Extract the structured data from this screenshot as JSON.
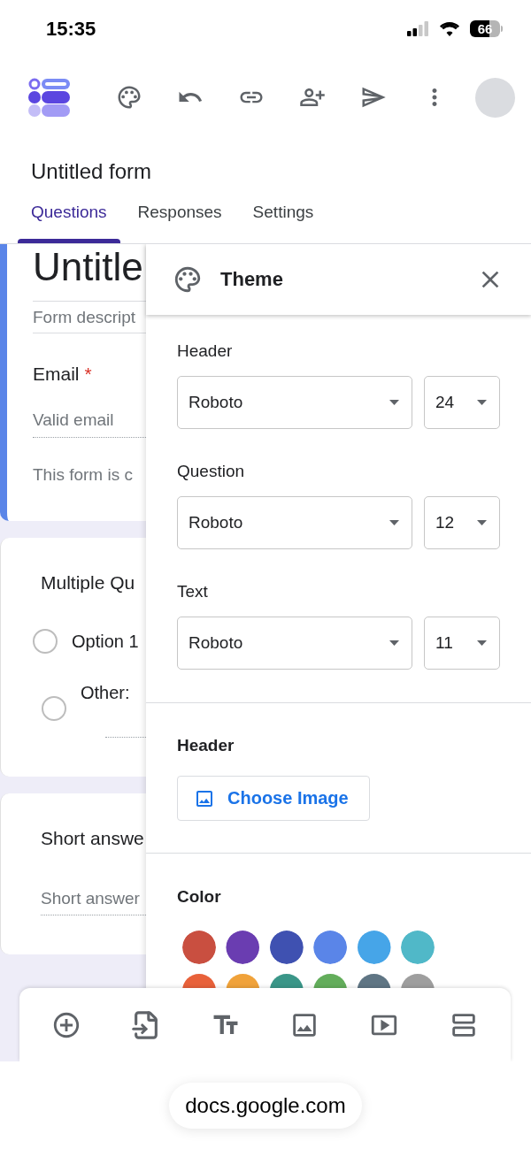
{
  "status_bar": {
    "time": "15:35",
    "battery": "66"
  },
  "form_title": "Untitled form",
  "tabs": [
    {
      "label": "Questions",
      "selected": true
    },
    {
      "label": "Responses",
      "selected": false
    },
    {
      "label": "Settings",
      "selected": false
    }
  ],
  "header_card": {
    "title": "Untitle",
    "description_placeholder": "Form descript",
    "question": {
      "label": "Email",
      "required_mark": "*",
      "placeholder": "Valid email"
    },
    "note": "This form is c"
  },
  "questions": [
    {
      "kind": "multiple_choice",
      "title": "Multiple Qu",
      "options": [
        {
          "kind": "option",
          "label": "Option 1",
          "selected": false
        },
        {
          "kind": "other",
          "label": "Other:",
          "selected": false
        }
      ]
    },
    {
      "kind": "short_answer",
      "title": "Short answe",
      "placeholder": "Short answer"
    }
  ],
  "theme_panel": {
    "title": "Theme",
    "text_styles": [
      {
        "label": "Header",
        "font": "Roboto",
        "size": "24"
      },
      {
        "label": "Question",
        "font": "Roboto",
        "size": "12"
      },
      {
        "label": "Text",
        "font": "Roboto",
        "size": "11"
      }
    ],
    "header_section": {
      "title": "Header",
      "button": "Choose Image"
    },
    "color_section": {
      "title": "Color",
      "colors": [
        {
          "color": "#c94f40"
        },
        {
          "color": "#6a3db1"
        },
        {
          "color": "#3f51b1"
        },
        {
          "color": "#5a85e8"
        },
        {
          "color": "#46a5e8"
        },
        {
          "color": "#50b8c8"
        },
        {
          "color": "#e8613a"
        },
        {
          "color": "#f0a23a"
        },
        {
          "color": "#3a9688"
        },
        {
          "color": "#63ad5b"
        },
        {
          "color": "#5f7584"
        },
        {
          "color": "#9e9e9e"
        }
      ]
    }
  },
  "url_bar": {
    "url": "docs.google.com"
  }
}
